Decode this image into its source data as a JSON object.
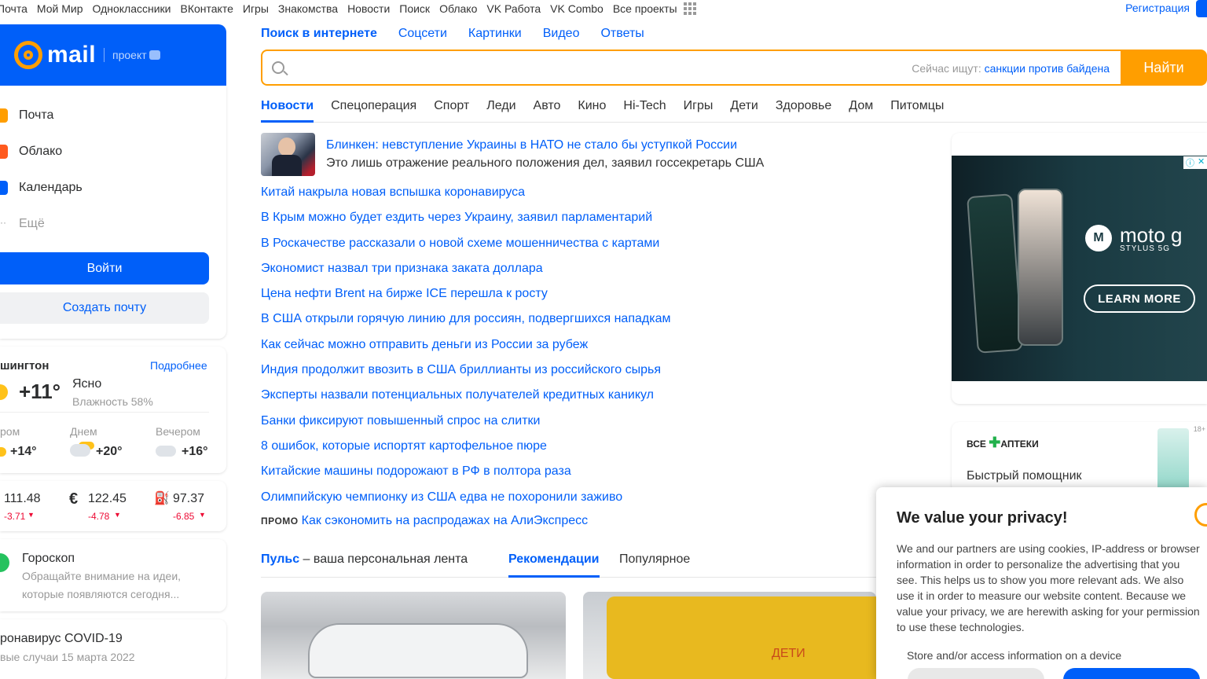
{
  "topbar": {
    "projects": [
      "Почта",
      "Мой Мир",
      "Одноклассники",
      "ВКонтакте",
      "Игры",
      "Знакомства",
      "Новости",
      "Поиск",
      "Облако",
      "VK Работа",
      "VK Combo",
      "Все проекты"
    ],
    "register": "Регистрация"
  },
  "logo": {
    "text": "mail",
    "project": "проект"
  },
  "menu": {
    "items": [
      {
        "label": "Почта",
        "color": "#ff9e00"
      },
      {
        "label": "Облако",
        "color": "#ff5a1e"
      },
      {
        "label": "Календарь",
        "color": "#005ff9"
      },
      {
        "label": "Ещё",
        "color": "#999999"
      }
    ],
    "login": "Войти",
    "create": "Создать почту"
  },
  "weather": {
    "city": "шингтон",
    "more": "Подробнее",
    "temp": "+11°",
    "cond": "Ясно",
    "humidity": "Влажность 58%",
    "parts": [
      {
        "label": "ром",
        "temp": "+14°"
      },
      {
        "label": "Днем",
        "temp": "+20°"
      },
      {
        "label": "Вечером",
        "temp": "+16°"
      }
    ]
  },
  "rates": [
    {
      "sym": "",
      "value": "111.48",
      "delta": "-3.71"
    },
    {
      "sym": "€",
      "value": "122.45",
      "delta": "-4.78"
    },
    {
      "sym": "⛽",
      "value": "97.37",
      "delta": "-6.85"
    }
  ],
  "horoscope": {
    "title": "Гороскоп",
    "text1": "Обращайте внимание на идеи,",
    "text2": "которые появляются сегодня..."
  },
  "covid": {
    "title": "ронавирус COVID-19",
    "sub": "вые случаи 15 марта 2022"
  },
  "search": {
    "tabs": [
      "Поиск в интернете",
      "Соцсети",
      "Картинки",
      "Видео",
      "Ответы"
    ],
    "now_label": "Сейчас ищут:",
    "now_query": "санкции против байдена",
    "button": "Найти"
  },
  "news": {
    "tabs": [
      "Новости",
      "Спецоперация",
      "Спорт",
      "Леди",
      "Авто",
      "Кино",
      "Hi-Tech",
      "Игры",
      "Дети",
      "Здоровье",
      "Дом",
      "Питомцы"
    ],
    "lead_title": "Блинкен: невступление Украины в НАТО не стало бы уступкой России",
    "lead_sub": "Это лишь отражение реального положения дел, заявил госсекретарь США",
    "items": [
      "Китай накрыла новая вспышка коронавируса",
      "В Крым можно будет ездить через Украину, заявил парламентарий",
      "В Роскачестве рассказали о новой схеме мошенничества с картами",
      "Экономист назвал три признака заката доллара",
      "Цена нефти Brent на бирже ICE перешла к росту",
      "В США открыли горячую линию для россиян, подвергшихся нападкам",
      "Как сейчас можно отправить деньги из России за рубеж",
      "Индия продолжит ввозить в США бриллианты из российского сырья",
      "Эксперты назвали потенциальных получателей кредитных каникул",
      "Банки фиксируют повышенный спрос на слитки",
      "8 ошибок, которые испортят картофельное пюре",
      "Китайские машины подорожают в РФ в полтора раза",
      "Олимпийскую чемпионку из США едва не похоронили заживо"
    ],
    "promo_label": "ПРОМО",
    "promo": "Как сэкономить на распродажах на АлиЭкспресс"
  },
  "pulse": {
    "title": "Пульс",
    "desc": " – ваша персональная лента",
    "rec": "Рекомендации",
    "pop": "Популярное",
    "img2_text": "ДЕТИ"
  },
  "ad": {
    "brand": "moto g",
    "sub": "STYLUS 5G",
    "cta": "LEARN MORE"
  },
  "apteki": {
    "logo_a": "ВСЕ",
    "logo_b": "АПТЕКИ",
    "text": "Быстрый помощник",
    "age": "18+"
  },
  "privacy": {
    "title": "We value your privacy!",
    "text": "We and our partners are using cookies, IP-address or browser information in order to personalize the advertising that you see. This helps us to show you more relevant ads. We also use it in order to measure our website content. Because we value your privacy, we are herewith asking for your permission to use these technologies.",
    "store": "Store and/or access information on a device"
  }
}
